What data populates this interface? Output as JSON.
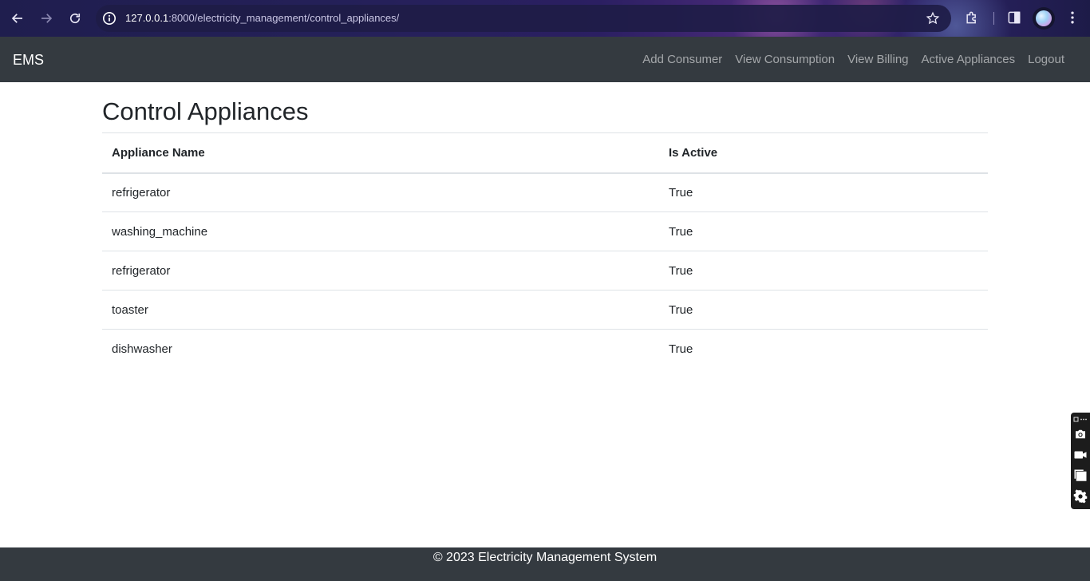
{
  "browser": {
    "url_host": "127.0.0.1",
    "url_rest": ":8000/electricity_management/control_appliances/"
  },
  "navbar": {
    "brand": "EMS",
    "links": [
      "Add Consumer",
      "View Consumption",
      "View Billing",
      "Active Appliances",
      "Logout"
    ]
  },
  "main": {
    "title": "Control Appliances",
    "table": {
      "headers": [
        "Appliance Name",
        "Is Active"
      ],
      "rows": [
        [
          "refrigerator",
          "True"
        ],
        [
          "washing_machine",
          "True"
        ],
        [
          "refrigerator",
          "True"
        ],
        [
          "toaster",
          "True"
        ],
        [
          "dishwasher",
          "True"
        ]
      ]
    }
  },
  "footer": {
    "text": "© 2023 Electricity Management System"
  },
  "icons": {
    "back": "arrow-left-icon",
    "forward": "arrow-right-icon",
    "reload": "reload-icon",
    "info": "info-icon",
    "star": "star-icon",
    "extensions": "puzzle-icon",
    "sidepanel": "side-panel-icon",
    "menu": "kebab-menu-icon",
    "tools": [
      "camera-icon",
      "video-icon",
      "window-icon",
      "gear-icon"
    ]
  }
}
